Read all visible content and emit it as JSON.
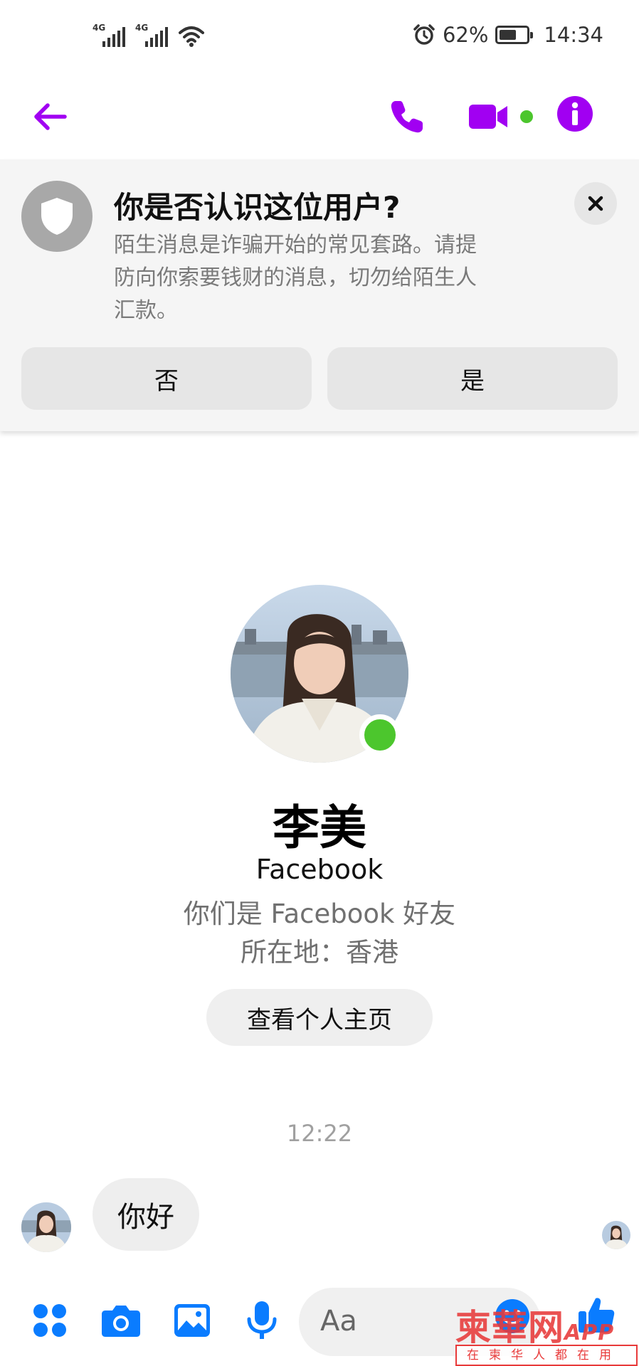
{
  "status_bar": {
    "signal_1_label": "4G",
    "signal_2_label": "4G",
    "battery_percent": "62%",
    "battery_level": 0.62,
    "time": "14:34",
    "icons": [
      "signal-icon",
      "wifi-icon",
      "alarm-icon",
      "battery-icon"
    ]
  },
  "header": {
    "icons": [
      "back-arrow-icon",
      "phone-icon",
      "video-camera-icon",
      "info-icon"
    ],
    "accent_color": "#a100f2",
    "online_dot_color": "#4cc62d"
  },
  "warning": {
    "title": "你是否认识这位用户?",
    "body_line_1": "陌生消息是诈骗开始的常见套路。请提",
    "body_line_2": "防向你索要钱财的消息，切勿给陌生人",
    "body_line_3": "汇款。",
    "no_label": "否",
    "yes_label": "是"
  },
  "profile": {
    "name": "李美",
    "platform": "Facebook",
    "relationship": "你们是 Facebook 好友",
    "location": "所在地：香港",
    "view_profile_label": "查看个人主页"
  },
  "conversation": {
    "timestamp": "12:22",
    "messages": [
      {
        "text": "你好"
      }
    ]
  },
  "composer": {
    "placeholder": "Aa",
    "icons": [
      "apps-icon",
      "camera-icon",
      "gallery-icon",
      "microphone-icon",
      "emoji-icon",
      "thumbs-up-icon"
    ],
    "icon_color": "#0a7cff"
  },
  "watermark": {
    "brand": "柬華网",
    "app_label": "APP",
    "tagline": "在柬华人都在用"
  }
}
